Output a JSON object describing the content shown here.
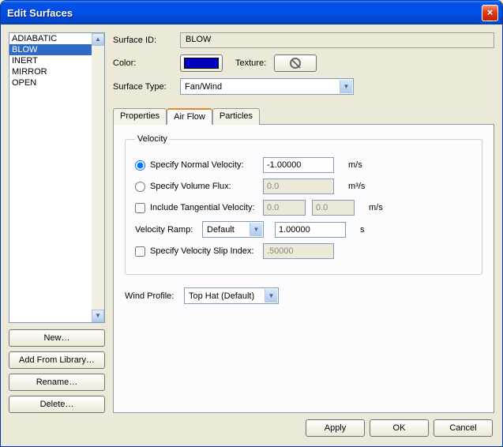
{
  "window": {
    "title": "Edit Surfaces",
    "close": "×"
  },
  "list": {
    "items": [
      "ADIABATIC",
      "BLOW",
      "INERT",
      "MIRROR",
      "OPEN"
    ],
    "selected_index": 1
  },
  "left_buttons": {
    "new": "New…",
    "add_lib": "Add From Library…",
    "rename": "Rename…",
    "delete": "Delete…"
  },
  "fields": {
    "surface_id_label": "Surface ID:",
    "surface_id_value": "BLOW",
    "color_label": "Color:",
    "color_hex": "#0000c0",
    "texture_label": "Texture:",
    "surface_type_label": "Surface Type:",
    "surface_type_value": "Fan/Wind"
  },
  "tabs": {
    "items": [
      "Properties",
      "Air Flow",
      "Particles"
    ],
    "active_index": 1
  },
  "velocity": {
    "legend": "Velocity",
    "normal_label": "Specify Normal Velocity:",
    "normal_value": "-1.00000",
    "normal_unit": "m/s",
    "volflux_label": "Specify Volume Flux:",
    "volflux_value": "0.0",
    "volflux_unit": "m³/s",
    "tangential_label": "Include Tangential Velocity:",
    "tangential_u": "0.0",
    "tangential_v": "0.0",
    "tangential_unit": "m/s",
    "ramp_label": "Velocity Ramp:",
    "ramp_select": "Default",
    "ramp_value": "1.00000",
    "ramp_unit": "s",
    "slip_label": "Specify Velocity Slip Index:",
    "slip_value": ".50000"
  },
  "wind": {
    "label": "Wind Profile:",
    "value": "Top Hat (Default)"
  },
  "footer": {
    "apply": "Apply",
    "ok": "OK",
    "cancel": "Cancel"
  }
}
